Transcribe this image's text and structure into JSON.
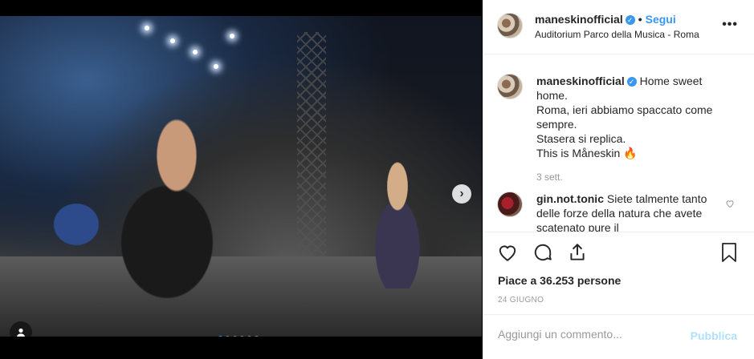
{
  "header": {
    "username": "maneskinofficial",
    "separator": "•",
    "follow_label": "Segui",
    "location": "Auditorium Parco della Musica - Roma",
    "more_label": "•••"
  },
  "caption": {
    "username": "maneskinofficial",
    "lines": [
      "Home sweet home.",
      "Roma, ieri abbiamo spaccato come sempre.",
      "Stasera si replica.",
      "This is Måneskin 🔥"
    ],
    "time": "3 sett."
  },
  "comment": {
    "username": "gin.not.tonic",
    "text": "Siete talmente tanto delle forze della natura che avete scatenato pure il"
  },
  "stats": {
    "likes": "Piace a 36.253 persone",
    "date": "24 GIUGNO"
  },
  "add_comment": {
    "placeholder": "Aggiungi un commento...",
    "publish_label": "Pubblica"
  },
  "carousel": {
    "next_label": "›",
    "slides": 6,
    "active_index": 0
  },
  "icons": {
    "verified": "verified-badge-icon",
    "like": "heart-icon",
    "comment": "comment-icon",
    "share": "share-icon",
    "save": "bookmark-icon",
    "tag": "user-tag-icon"
  },
  "colors": {
    "accent": "#3897f0",
    "publish_disabled": "#b2dffc"
  }
}
